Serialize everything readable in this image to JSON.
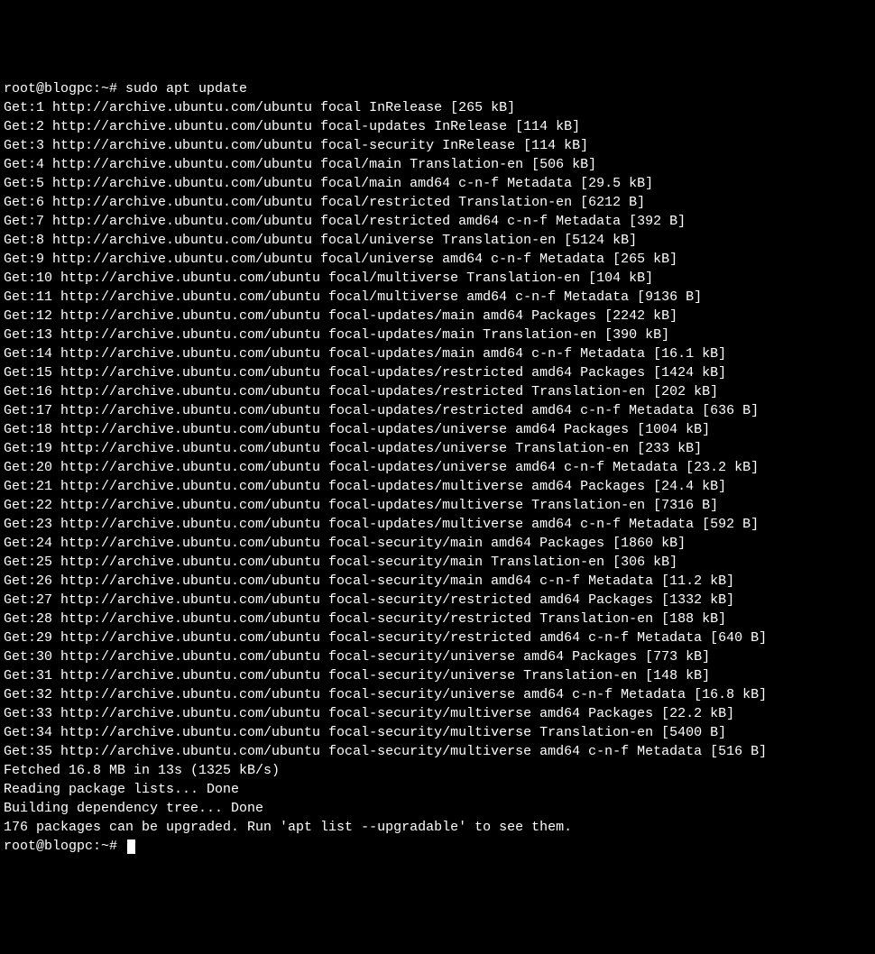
{
  "prompt1": "root@blogpc:~# ",
  "command": "sudo apt update",
  "base_url": "http://archive.ubuntu.com/ubuntu",
  "entries": [
    {
      "n": 1,
      "repo": "focal InRelease",
      "size": "265 kB"
    },
    {
      "n": 2,
      "repo": "focal-updates InRelease",
      "size": "114 kB"
    },
    {
      "n": 3,
      "repo": "focal-security InRelease",
      "size": "114 kB"
    },
    {
      "n": 4,
      "repo": "focal/main Translation-en",
      "size": "506 kB"
    },
    {
      "n": 5,
      "repo": "focal/main amd64 c-n-f Metadata",
      "size": "29.5 kB"
    },
    {
      "n": 6,
      "repo": "focal/restricted Translation-en",
      "size": "6212 B"
    },
    {
      "n": 7,
      "repo": "focal/restricted amd64 c-n-f Metadata",
      "size": "392 B"
    },
    {
      "n": 8,
      "repo": "focal/universe Translation-en",
      "size": "5124 kB"
    },
    {
      "n": 9,
      "repo": "focal/universe amd64 c-n-f Metadata",
      "size": "265 kB"
    },
    {
      "n": 10,
      "repo": "focal/multiverse Translation-en",
      "size": "104 kB"
    },
    {
      "n": 11,
      "repo": "focal/multiverse amd64 c-n-f Metadata",
      "size": "9136 B"
    },
    {
      "n": 12,
      "repo": "focal-updates/main amd64 Packages",
      "size": "2242 kB"
    },
    {
      "n": 13,
      "repo": "focal-updates/main Translation-en",
      "size": "390 kB"
    },
    {
      "n": 14,
      "repo": "focal-updates/main amd64 c-n-f Metadata",
      "size": "16.1 kB"
    },
    {
      "n": 15,
      "repo": "focal-updates/restricted amd64 Packages",
      "size": "1424 kB"
    },
    {
      "n": 16,
      "repo": "focal-updates/restricted Translation-en",
      "size": "202 kB"
    },
    {
      "n": 17,
      "repo": "focal-updates/restricted amd64 c-n-f Metadata",
      "size": "636 B"
    },
    {
      "n": 18,
      "repo": "focal-updates/universe amd64 Packages",
      "size": "1004 kB"
    },
    {
      "n": 19,
      "repo": "focal-updates/universe Translation-en",
      "size": "233 kB"
    },
    {
      "n": 20,
      "repo": "focal-updates/universe amd64 c-n-f Metadata",
      "size": "23.2 kB"
    },
    {
      "n": 21,
      "repo": "focal-updates/multiverse amd64 Packages",
      "size": "24.4 kB"
    },
    {
      "n": 22,
      "repo": "focal-updates/multiverse Translation-en",
      "size": "7316 B"
    },
    {
      "n": 23,
      "repo": "focal-updates/multiverse amd64 c-n-f Metadata",
      "size": "592 B"
    },
    {
      "n": 24,
      "repo": "focal-security/main amd64 Packages",
      "size": "1860 kB"
    },
    {
      "n": 25,
      "repo": "focal-security/main Translation-en",
      "size": "306 kB"
    },
    {
      "n": 26,
      "repo": "focal-security/main amd64 c-n-f Metadata",
      "size": "11.2 kB"
    },
    {
      "n": 27,
      "repo": "focal-security/restricted amd64 Packages",
      "size": "1332 kB"
    },
    {
      "n": 28,
      "repo": "focal-security/restricted Translation-en",
      "size": "188 kB"
    },
    {
      "n": 29,
      "repo": "focal-security/restricted amd64 c-n-f Metadata",
      "size": "640 B"
    },
    {
      "n": 30,
      "repo": "focal-security/universe amd64 Packages",
      "size": "773 kB"
    },
    {
      "n": 31,
      "repo": "focal-security/universe Translation-en",
      "size": "148 kB"
    },
    {
      "n": 32,
      "repo": "focal-security/universe amd64 c-n-f Metadata",
      "size": "16.8 kB"
    },
    {
      "n": 33,
      "repo": "focal-security/multiverse amd64 Packages",
      "size": "22.2 kB"
    },
    {
      "n": 34,
      "repo": "focal-security/multiverse Translation-en",
      "size": "5400 B"
    },
    {
      "n": 35,
      "repo": "focal-security/multiverse amd64 c-n-f Metadata",
      "size": "516 B"
    }
  ],
  "fetched": "Fetched 16.8 MB in 13s (1325 kB/s)",
  "reading": "Reading package lists... Done",
  "building": "Building dependency tree... Done",
  "upgradable": "176 packages can be upgraded. Run 'apt list --upgradable' to see them.",
  "prompt2": "root@blogpc:~# "
}
